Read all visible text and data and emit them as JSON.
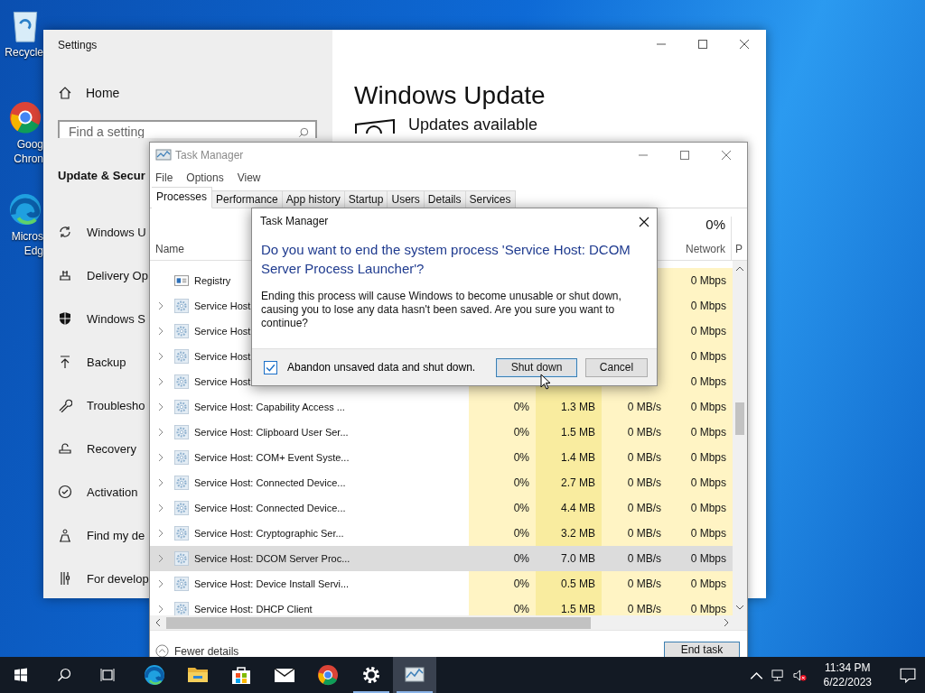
{
  "desktop_icons": [
    {
      "kind": "recycle-bin",
      "lines": [
        "Recycle"
      ]
    },
    {
      "kind": "chrome",
      "lines": [
        "Goog",
        "Chron"
      ]
    },
    {
      "kind": "edge",
      "lines": [
        "Micros",
        "Edg"
      ]
    }
  ],
  "settings": {
    "title": "Settings",
    "home": "Home",
    "search": {
      "placeholder": "Find a setting"
    },
    "section": "Update & Secur",
    "items": [
      {
        "kind": "sync",
        "label": "Windows U"
      },
      {
        "kind": "delivery",
        "label": "Delivery Op"
      },
      {
        "kind": "shield",
        "label": "Windows S"
      },
      {
        "kind": "backup",
        "label": "Backup"
      },
      {
        "kind": "wrench",
        "label": "Troublesho"
      },
      {
        "kind": "recovery",
        "label": "Recovery"
      },
      {
        "kind": "check",
        "label": "Activation"
      },
      {
        "kind": "person",
        "label": "Find my de"
      },
      {
        "kind": "tools",
        "label": "For develop"
      }
    ],
    "page_title": "Windows Update",
    "status": "Updates available"
  },
  "task_manager": {
    "title": "Task Manager",
    "menu": [
      "File",
      "Options",
      "View"
    ],
    "tabs": [
      {
        "label": "Processes",
        "selected": true
      },
      {
        "label": "Performance",
        "selected": false
      },
      {
        "label": "App history",
        "selected": false
      },
      {
        "label": "Startup",
        "selected": false
      },
      {
        "label": "Users",
        "selected": false
      },
      {
        "label": "Details",
        "selected": false
      },
      {
        "label": "Services",
        "selected": false
      }
    ],
    "columns": {
      "name": "Name",
      "network_usage": "0%",
      "network": "Network",
      "column_6": "P"
    },
    "rows": [
      {
        "kind": "registry",
        "expandable": false,
        "selected": false,
        "name": "Registry",
        "network": "0 Mbps"
      },
      {
        "kind": "service",
        "expandable": true,
        "selected": false,
        "name": "Service Host",
        "network": "0 Mbps"
      },
      {
        "kind": "service",
        "expandable": true,
        "selected": false,
        "name": "Service Host",
        "network": "0 Mbps"
      },
      {
        "kind": "service",
        "expandable": true,
        "selected": false,
        "name": "Service Host",
        "network": "0 Mbps"
      },
      {
        "kind": "service",
        "expandable": true,
        "selected": false,
        "name": "Service Host",
        "network": "0 Mbps"
      },
      {
        "kind": "service",
        "expandable": true,
        "selected": false,
        "name": "Service Host: Capability Access ...",
        "cpu": "0%",
        "memory": "1.3 MB",
        "disk": "0 MB/s",
        "network": "0 Mbps"
      },
      {
        "kind": "service",
        "expandable": true,
        "selected": false,
        "name": "Service Host: Clipboard User Ser...",
        "cpu": "0%",
        "memory": "1.5 MB",
        "disk": "0 MB/s",
        "network": "0 Mbps"
      },
      {
        "kind": "service",
        "expandable": true,
        "selected": false,
        "name": "Service Host: COM+ Event Syste...",
        "cpu": "0%",
        "memory": "1.4 MB",
        "disk": "0 MB/s",
        "network": "0 Mbps"
      },
      {
        "kind": "service",
        "expandable": true,
        "selected": false,
        "name": "Service Host: Connected Device...",
        "cpu": "0%",
        "memory": "2.7 MB",
        "disk": "0 MB/s",
        "network": "0 Mbps"
      },
      {
        "kind": "service",
        "expandable": true,
        "selected": false,
        "name": "Service Host: Connected Device...",
        "cpu": "0%",
        "memory": "4.4 MB",
        "disk": "0 MB/s",
        "network": "0 Mbps"
      },
      {
        "kind": "service",
        "expandable": true,
        "selected": false,
        "name": "Service Host: Cryptographic Ser...",
        "cpu": "0%",
        "memory": "3.2 MB",
        "disk": "0 MB/s",
        "network": "0 Mbps"
      },
      {
        "kind": "service",
        "expandable": true,
        "selected": true,
        "name": "Service Host: DCOM Server Proc...",
        "cpu": "0%",
        "memory": "7.0 MB",
        "disk": "0 MB/s",
        "network": "0 Mbps"
      },
      {
        "kind": "service",
        "expandable": true,
        "selected": false,
        "name": "Service Host: Device Install Servi...",
        "cpu": "0%",
        "memory": "0.5 MB",
        "disk": "0 MB/s",
        "network": "0 Mbps"
      },
      {
        "kind": "service",
        "expandable": true,
        "selected": false,
        "name": "Service Host: DHCP Client",
        "cpu": "0%",
        "memory": "1.5 MB",
        "disk": "0 MB/s",
        "network": "0 Mbps"
      }
    ],
    "fewer_details": "Fewer details",
    "end_task": "End task"
  },
  "dialog": {
    "title": "Task Manager",
    "heading": "Do you want to end the system process 'Service Host: DCOM Server Process Launcher'?",
    "message": "Ending this process will cause Windows to become unusable or shut down, causing you to lose any data hasn't been saved. Are you sure you want to continue?",
    "checkbox": {
      "label": "Abandon unsaved data and shut down.",
      "checked": true
    },
    "buttons": [
      {
        "label": "Shut down",
        "focused": true
      },
      {
        "label": "Cancel",
        "focused": false
      }
    ]
  },
  "taskbar": {
    "apps": [
      {
        "kind": "edge",
        "open": false,
        "active": false
      },
      {
        "kind": "folder",
        "open": false,
        "active": false
      },
      {
        "kind": "store",
        "open": false,
        "active": false
      },
      {
        "kind": "mail",
        "open": false,
        "active": false
      },
      {
        "kind": "chrome",
        "open": false,
        "active": false
      },
      {
        "kind": "settings",
        "open": true,
        "active": false
      },
      {
        "kind": "taskmanager",
        "open": true,
        "active": true
      }
    ],
    "time": "11:34 PM",
    "date": "6/22/2023"
  }
}
